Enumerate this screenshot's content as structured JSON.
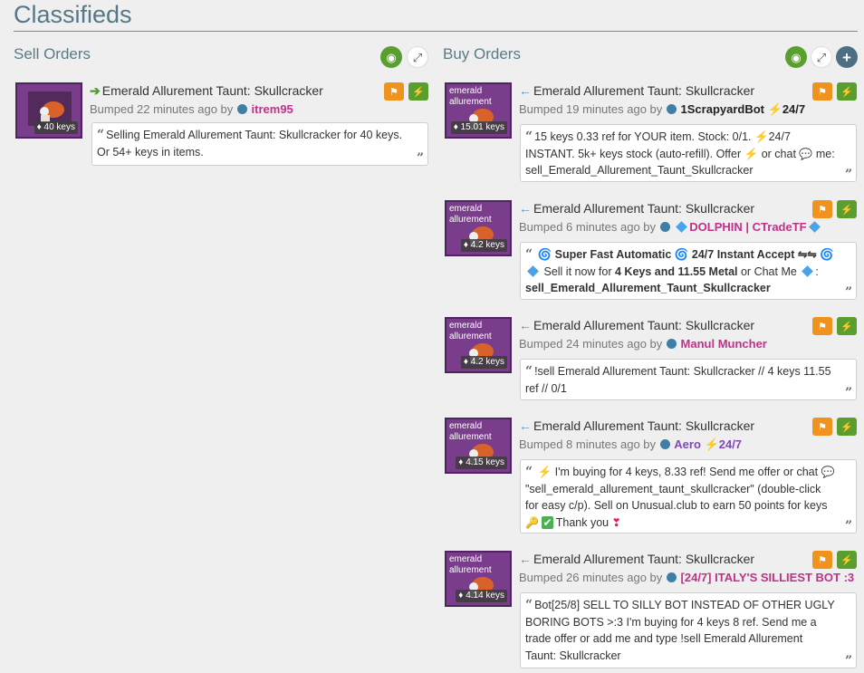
{
  "page_title": "Classifieds",
  "sell_heading": "Sell Orders",
  "buy_heading": "Buy Orders",
  "icons": {
    "watch": "eye-icon",
    "expand": "expand-icon",
    "add": "plus-icon",
    "flag": "flag-icon",
    "quick": "lightning-icon"
  },
  "sell": [
    {
      "item": "Emerald Allurement Taunt: Skullcracker",
      "price": "40 keys",
      "bumped": "Bumped 22 minutes ago by",
      "user": "itrem95",
      "desc": "Selling Emerald Allurement Taunt: Skullcracker for 40 keys. Or 54+ keys in items."
    }
  ],
  "buy": [
    {
      "item": "Emerald Allurement Taunt: Skullcracker",
      "thumb_label": "emerald allurement",
      "price": "15.01 keys",
      "bumped": "Bumped 19 minutes ago by",
      "user": "1ScrapyardBot",
      "user_suffix": "24/7",
      "desc_a": "15 keys 0.33 ref for YOUR item. Stock: 0/1.",
      "desc_b": "24/7 INSTANT. 5k+ keys stock (auto-refill). Offer",
      "desc_c": "or chat",
      "desc_d": "me: sell_Emerald_Allurement_Taunt_Skullcracker"
    },
    {
      "item": "Emerald Allurement Taunt: Skullcracker",
      "thumb_label": "emerald allurement",
      "price": "4.2 keys",
      "bumped": "Bumped 6 minutes ago by",
      "user": "DOLPHIN | CTradeTF",
      "desc_a": "Super Fast Automatic",
      "desc_b": "24/7 Instant Accept ⇋⇋",
      "desc_c": "Sell it now for",
      "desc_d": "4 Keys and 11.55 Metal",
      "desc_e": "or Chat Me",
      "desc_f": ":",
      "desc_g": "sell_Emerald_Allurement_Taunt_Skullcracker"
    },
    {
      "item": "Emerald Allurement Taunt: Skullcracker",
      "thumb_label": "emerald allurement",
      "price": "4.2 keys",
      "bumped": "Bumped 24 minutes ago by",
      "user": "Manul Muncher",
      "desc": "!sell Emerald Allurement Taunt: Skullcracker // 4 keys 11.55 ref // 0/1"
    },
    {
      "item": "Emerald Allurement Taunt: Skullcracker",
      "thumb_label": "emerald allurement",
      "price": "4.15 keys",
      "bumped": "Bumped 8 minutes ago by",
      "user": "Aero",
      "user_suffix": "24/7",
      "desc_a": "I'm buying for 4 keys, 8.33 ref! Send me offer or chat",
      "desc_b": "\"sell_emerald_allurement_taunt_skullcracker\" (double-click for easy c/p). Sell on Unusual.club to earn 50 points for keys",
      "desc_c": "Thank you"
    },
    {
      "item": "Emerald Allurement Taunt: Skullcracker",
      "thumb_label": "emerald allurement",
      "price": "4.14 keys",
      "bumped": "Bumped 26 minutes ago by",
      "user": "[24/7] ITALY'S SILLIEST BOT :3",
      "desc": "Bot[25/8] SELL TO SILLY BOT INSTEAD OF OTHER UGLY BORING BOTS >:3 I'm buying for 4 keys 8 ref. Send me a trade offer or add me and type !sell Emerald Allurement Taunt: Skullcracker"
    }
  ]
}
